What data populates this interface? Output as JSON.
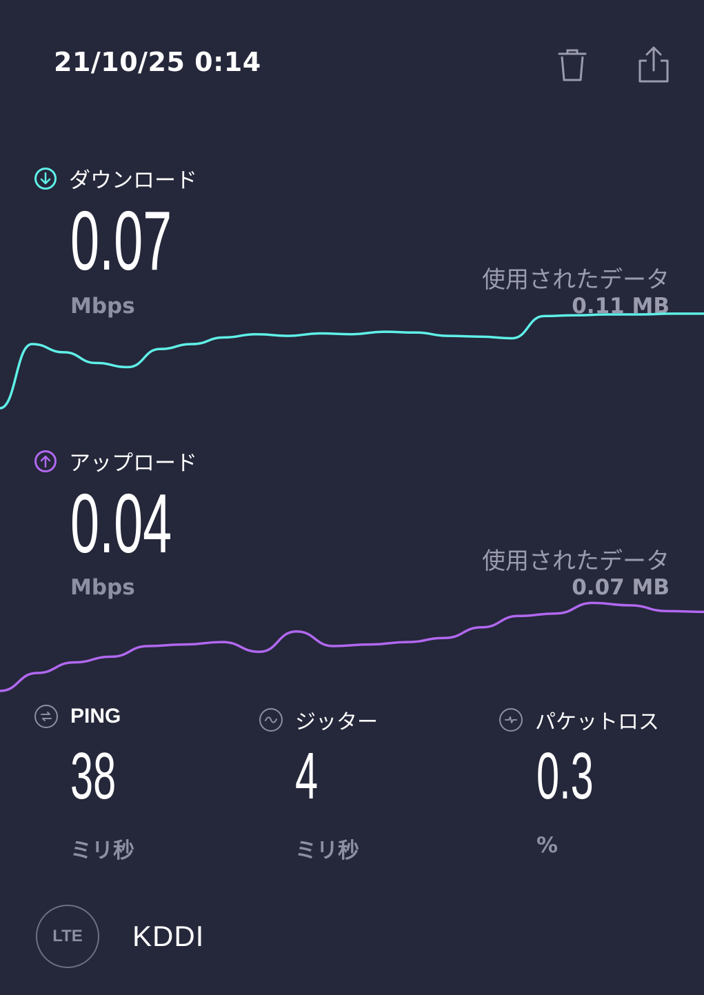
{
  "header": {
    "timestamp": "21/10/25 0:14",
    "delete_icon": "trash-icon",
    "share_icon": "share-icon"
  },
  "download": {
    "label": "ダウンロード",
    "icon": "download-arrow-icon",
    "value": "0.07",
    "unit": "Mbps",
    "data_used_label": "使用されたデータ",
    "data_used_value": "0.11 MB",
    "color": "#5ff0e8",
    "trace": [
      0.0,
      0.78,
      0.68,
      0.55,
      0.5,
      0.72,
      0.78,
      0.86,
      0.9,
      0.88,
      0.91,
      0.9,
      0.93,
      0.92,
      0.88,
      0.87,
      0.85,
      1.12,
      1.13,
      1.14,
      1.14,
      1.15,
      1.15
    ]
  },
  "upload": {
    "label": "アップロード",
    "icon": "upload-arrow-icon",
    "value": "0.04",
    "unit": "Mbps",
    "data_used_label": "使用されたデータ",
    "data_used_value": "0.07 MB",
    "color": "#b168f0",
    "trace": [
      0.0,
      0.22,
      0.35,
      0.42,
      0.55,
      0.57,
      0.6,
      0.48,
      0.73,
      0.55,
      0.57,
      0.6,
      0.65,
      0.78,
      0.92,
      0.95,
      1.08,
      1.05,
      0.98,
      0.97
    ]
  },
  "stats": [
    {
      "key": "ping",
      "label": "PING",
      "icon": "ping-icon",
      "value": "38",
      "unit": "ミリ秒"
    },
    {
      "key": "jitter",
      "label": "ジッター",
      "icon": "jitter-icon",
      "value": "4",
      "unit": "ミリ秒"
    },
    {
      "key": "packet_loss",
      "label": "パケットロス",
      "icon": "packet-loss-icon",
      "value": "0.3",
      "unit": "%"
    }
  ],
  "connection": {
    "type_badge": "LTE",
    "carrier": "KDDI"
  }
}
